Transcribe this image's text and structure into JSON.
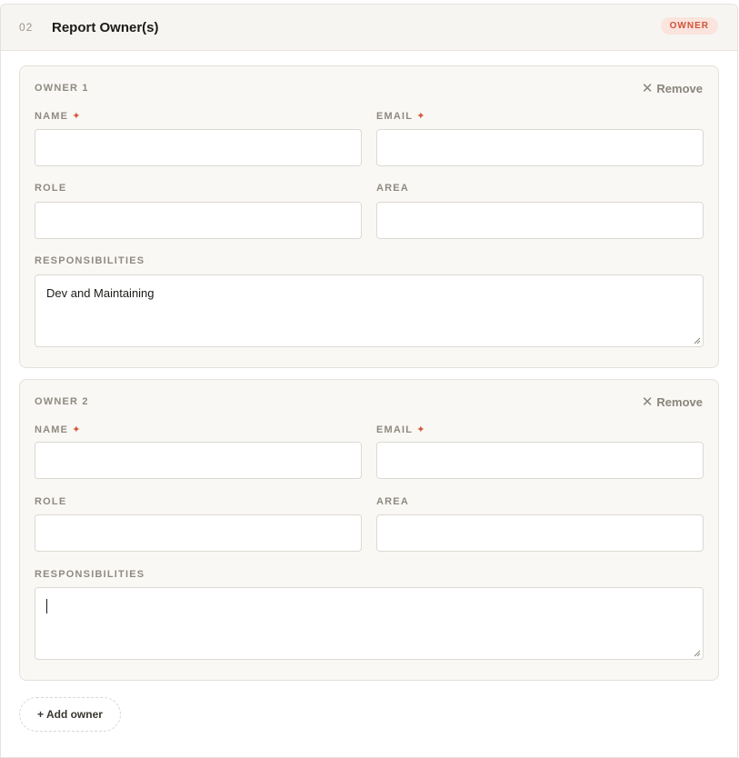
{
  "section": {
    "number": "02",
    "title": "Report Owner(s)",
    "badge": "OWNER"
  },
  "owners": [
    {
      "title": "OWNER 1",
      "remove_label": "Remove",
      "name_label": "NAME",
      "email_label": "EMAIL",
      "role_label": "ROLE",
      "area_label": "AREA",
      "responsibilities_label": "RESPONSIBILITIES",
      "name_value": "",
      "email_value": "",
      "role_value": "",
      "area_value": "",
      "responsibilities_value": "Dev and Maintaining"
    },
    {
      "title": "OWNER 2",
      "remove_label": "Remove",
      "name_label": "NAME",
      "email_label": "EMAIL",
      "role_label": "ROLE",
      "area_label": "AREA",
      "responsibilities_label": "RESPONSIBILITIES",
      "name_value": "",
      "email_value": "",
      "role_value": "",
      "area_value": "",
      "responsibilities_value": ""
    }
  ],
  "required_marker": "✦",
  "add_owner_label": "+ Add owner",
  "colors": {
    "accent": "#d65a3c",
    "badge_bg": "#fbe4dd",
    "header_bg": "#f6f5f1",
    "card_bg": "#f9f8f5"
  },
  "icons": {
    "remove": "close-icon",
    "required": "required-star-icon"
  }
}
